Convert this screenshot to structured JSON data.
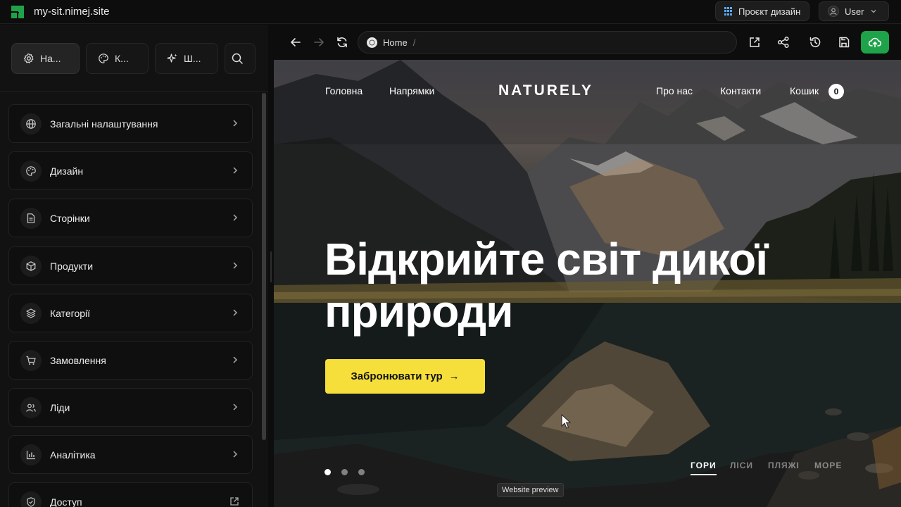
{
  "titlebar": {
    "site_url": "my-sit.nimej.site",
    "project_button": "Проєкт дизайн",
    "user_button": "User"
  },
  "sidebar": {
    "tabs": [
      {
        "label": "На...",
        "icon": "gear-icon"
      },
      {
        "label": "К...",
        "icon": "palette-icon"
      },
      {
        "label": "Ш...",
        "icon": "sparkle-icon"
      }
    ],
    "items": [
      {
        "label": "Загальні налаштування",
        "icon": "globe-icon"
      },
      {
        "label": "Дизайн",
        "icon": "palette-icon"
      },
      {
        "label": "Сторінки",
        "icon": "document-icon"
      },
      {
        "label": "Продукти",
        "icon": "box-icon"
      },
      {
        "label": "Категорії",
        "icon": "layers-icon"
      },
      {
        "label": "Замовлення",
        "icon": "cart-icon"
      },
      {
        "label": "Ліди",
        "icon": "users-icon"
      },
      {
        "label": "Аналітика",
        "icon": "chart-icon"
      },
      {
        "label": "Доступ",
        "icon": "shield-icon"
      }
    ]
  },
  "browser": {
    "address_page": "Home",
    "address_separator": "/"
  },
  "preview": {
    "nav": {
      "home": "Головна",
      "directions": "Напрямки",
      "brand": "NATURELY",
      "about": "Про нас",
      "contacts": "Контакти",
      "cart": "Кошик",
      "cart_count": "0"
    },
    "hero": {
      "title_line1": "Відкрийте світ дикої",
      "title_line2": "природи",
      "cta_label": "Забронювати тур",
      "cta_arrow": "→"
    },
    "slides": {
      "count": 3,
      "active": 1
    },
    "categories": [
      "ГОРИ",
      "ЛІСИ",
      "ПЛЯЖІ",
      "МОРЕ"
    ],
    "active_category": "ГОРИ",
    "tooltip": "Website preview"
  },
  "colors": {
    "accent_green": "#1fa34a",
    "cta_yellow": "#f6df3a",
    "background": "#0d0d0d"
  }
}
